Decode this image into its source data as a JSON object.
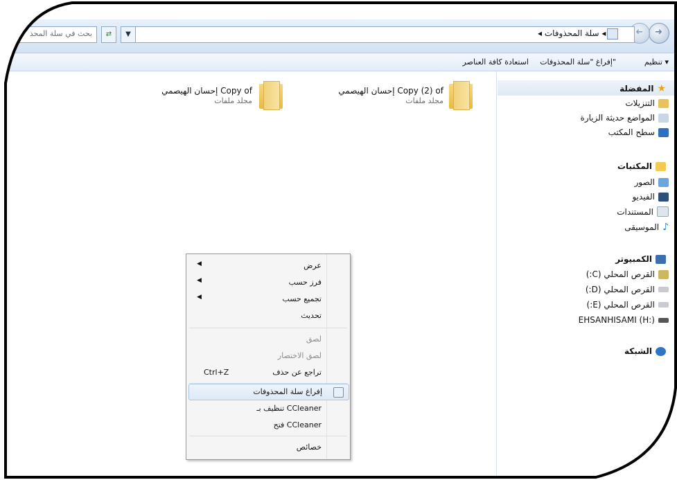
{
  "address_bar": {
    "search_placeholder": "بحث في سلة المحذ",
    "breadcrumb": "سلة المحذوفات",
    "back_icon": "back-arrow-icon",
    "forward_icon": "forward-arrow-icon"
  },
  "toolbar": {
    "organize": "تنظيم ▾",
    "empty_bin": "إفراغ \"سلة المحذوفات\"",
    "restore_all": "استعادة كافة العناصر"
  },
  "sidebar": {
    "favorites": {
      "header": "المفضلة",
      "items": [
        "التنزيلات",
        "المواضع حديثة الزيارة",
        "سطح المكتب"
      ]
    },
    "libraries": {
      "header": "المكتبات",
      "items": [
        "الصور",
        "الفيديو",
        "المستندات",
        "الموسيقى"
      ]
    },
    "computer": {
      "header": "الكمبيوتر",
      "items": [
        "القرص المحلي (C:)",
        "القرص المحلي (D:)",
        "القرص المحلي (E:)",
        "EHSANHISAMI (H:)"
      ]
    },
    "network": {
      "header": "الشبكة"
    }
  },
  "files": [
    {
      "name": "إحسان الهيصمي Copy (2) of",
      "type": "مجلد ملفات"
    },
    {
      "name": "إحسان الهيصمي Copy of",
      "type": "مجلد ملفات"
    }
  ],
  "context_menu": {
    "items": [
      {
        "label": "عرض",
        "submenu": true
      },
      {
        "label": "فرز حسب",
        "submenu": true
      },
      {
        "label": "تجميع حسب",
        "submenu": true
      },
      {
        "label": "تحديث"
      },
      {
        "label": "لصق",
        "disabled": true
      },
      {
        "label": "لصق الاختصار",
        "disabled": true
      },
      {
        "label": "تراجع عن حذف",
        "shortcut": "Ctrl+Z"
      },
      {
        "label": "إفراغ سلة المحذوفات",
        "highlighted": true
      },
      {
        "label": "تنظيف بـ CCleaner"
      },
      {
        "label": "فتح CCleaner"
      },
      {
        "label": "خصائص"
      }
    ]
  },
  "colors": {
    "accent": "#3b7ed4",
    "border": "#000000"
  }
}
